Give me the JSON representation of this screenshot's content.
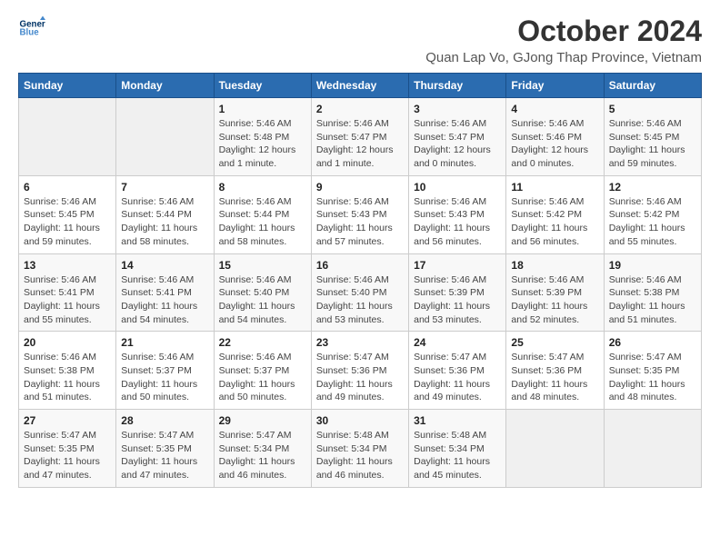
{
  "logo": {
    "line1": "General",
    "line2": "Blue"
  },
  "title": "October 2024",
  "subtitle": "Quan Lap Vo, GJong Thap Province, Vietnam",
  "weekdays": [
    "Sunday",
    "Monday",
    "Tuesday",
    "Wednesday",
    "Thursday",
    "Friday",
    "Saturday"
  ],
  "weeks": [
    [
      {
        "day": "",
        "info": ""
      },
      {
        "day": "",
        "info": ""
      },
      {
        "day": "1",
        "info": "Sunrise: 5:46 AM\nSunset: 5:48 PM\nDaylight: 12 hours\nand 1 minute."
      },
      {
        "day": "2",
        "info": "Sunrise: 5:46 AM\nSunset: 5:47 PM\nDaylight: 12 hours\nand 1 minute."
      },
      {
        "day": "3",
        "info": "Sunrise: 5:46 AM\nSunset: 5:47 PM\nDaylight: 12 hours\nand 0 minutes."
      },
      {
        "day": "4",
        "info": "Sunrise: 5:46 AM\nSunset: 5:46 PM\nDaylight: 12 hours\nand 0 minutes."
      },
      {
        "day": "5",
        "info": "Sunrise: 5:46 AM\nSunset: 5:45 PM\nDaylight: 11 hours\nand 59 minutes."
      }
    ],
    [
      {
        "day": "6",
        "info": "Sunrise: 5:46 AM\nSunset: 5:45 PM\nDaylight: 11 hours\nand 59 minutes."
      },
      {
        "day": "7",
        "info": "Sunrise: 5:46 AM\nSunset: 5:44 PM\nDaylight: 11 hours\nand 58 minutes."
      },
      {
        "day": "8",
        "info": "Sunrise: 5:46 AM\nSunset: 5:44 PM\nDaylight: 11 hours\nand 58 minutes."
      },
      {
        "day": "9",
        "info": "Sunrise: 5:46 AM\nSunset: 5:43 PM\nDaylight: 11 hours\nand 57 minutes."
      },
      {
        "day": "10",
        "info": "Sunrise: 5:46 AM\nSunset: 5:43 PM\nDaylight: 11 hours\nand 56 minutes."
      },
      {
        "day": "11",
        "info": "Sunrise: 5:46 AM\nSunset: 5:42 PM\nDaylight: 11 hours\nand 56 minutes."
      },
      {
        "day": "12",
        "info": "Sunrise: 5:46 AM\nSunset: 5:42 PM\nDaylight: 11 hours\nand 55 minutes."
      }
    ],
    [
      {
        "day": "13",
        "info": "Sunrise: 5:46 AM\nSunset: 5:41 PM\nDaylight: 11 hours\nand 55 minutes."
      },
      {
        "day": "14",
        "info": "Sunrise: 5:46 AM\nSunset: 5:41 PM\nDaylight: 11 hours\nand 54 minutes."
      },
      {
        "day": "15",
        "info": "Sunrise: 5:46 AM\nSunset: 5:40 PM\nDaylight: 11 hours\nand 54 minutes."
      },
      {
        "day": "16",
        "info": "Sunrise: 5:46 AM\nSunset: 5:40 PM\nDaylight: 11 hours\nand 53 minutes."
      },
      {
        "day": "17",
        "info": "Sunrise: 5:46 AM\nSunset: 5:39 PM\nDaylight: 11 hours\nand 53 minutes."
      },
      {
        "day": "18",
        "info": "Sunrise: 5:46 AM\nSunset: 5:39 PM\nDaylight: 11 hours\nand 52 minutes."
      },
      {
        "day": "19",
        "info": "Sunrise: 5:46 AM\nSunset: 5:38 PM\nDaylight: 11 hours\nand 51 minutes."
      }
    ],
    [
      {
        "day": "20",
        "info": "Sunrise: 5:46 AM\nSunset: 5:38 PM\nDaylight: 11 hours\nand 51 minutes."
      },
      {
        "day": "21",
        "info": "Sunrise: 5:46 AM\nSunset: 5:37 PM\nDaylight: 11 hours\nand 50 minutes."
      },
      {
        "day": "22",
        "info": "Sunrise: 5:46 AM\nSunset: 5:37 PM\nDaylight: 11 hours\nand 50 minutes."
      },
      {
        "day": "23",
        "info": "Sunrise: 5:47 AM\nSunset: 5:36 PM\nDaylight: 11 hours\nand 49 minutes."
      },
      {
        "day": "24",
        "info": "Sunrise: 5:47 AM\nSunset: 5:36 PM\nDaylight: 11 hours\nand 49 minutes."
      },
      {
        "day": "25",
        "info": "Sunrise: 5:47 AM\nSunset: 5:36 PM\nDaylight: 11 hours\nand 48 minutes."
      },
      {
        "day": "26",
        "info": "Sunrise: 5:47 AM\nSunset: 5:35 PM\nDaylight: 11 hours\nand 48 minutes."
      }
    ],
    [
      {
        "day": "27",
        "info": "Sunrise: 5:47 AM\nSunset: 5:35 PM\nDaylight: 11 hours\nand 47 minutes."
      },
      {
        "day": "28",
        "info": "Sunrise: 5:47 AM\nSunset: 5:35 PM\nDaylight: 11 hours\nand 47 minutes."
      },
      {
        "day": "29",
        "info": "Sunrise: 5:47 AM\nSunset: 5:34 PM\nDaylight: 11 hours\nand 46 minutes."
      },
      {
        "day": "30",
        "info": "Sunrise: 5:48 AM\nSunset: 5:34 PM\nDaylight: 11 hours\nand 46 minutes."
      },
      {
        "day": "31",
        "info": "Sunrise: 5:48 AM\nSunset: 5:34 PM\nDaylight: 11 hours\nand 45 minutes."
      },
      {
        "day": "",
        "info": ""
      },
      {
        "day": "",
        "info": ""
      }
    ]
  ]
}
